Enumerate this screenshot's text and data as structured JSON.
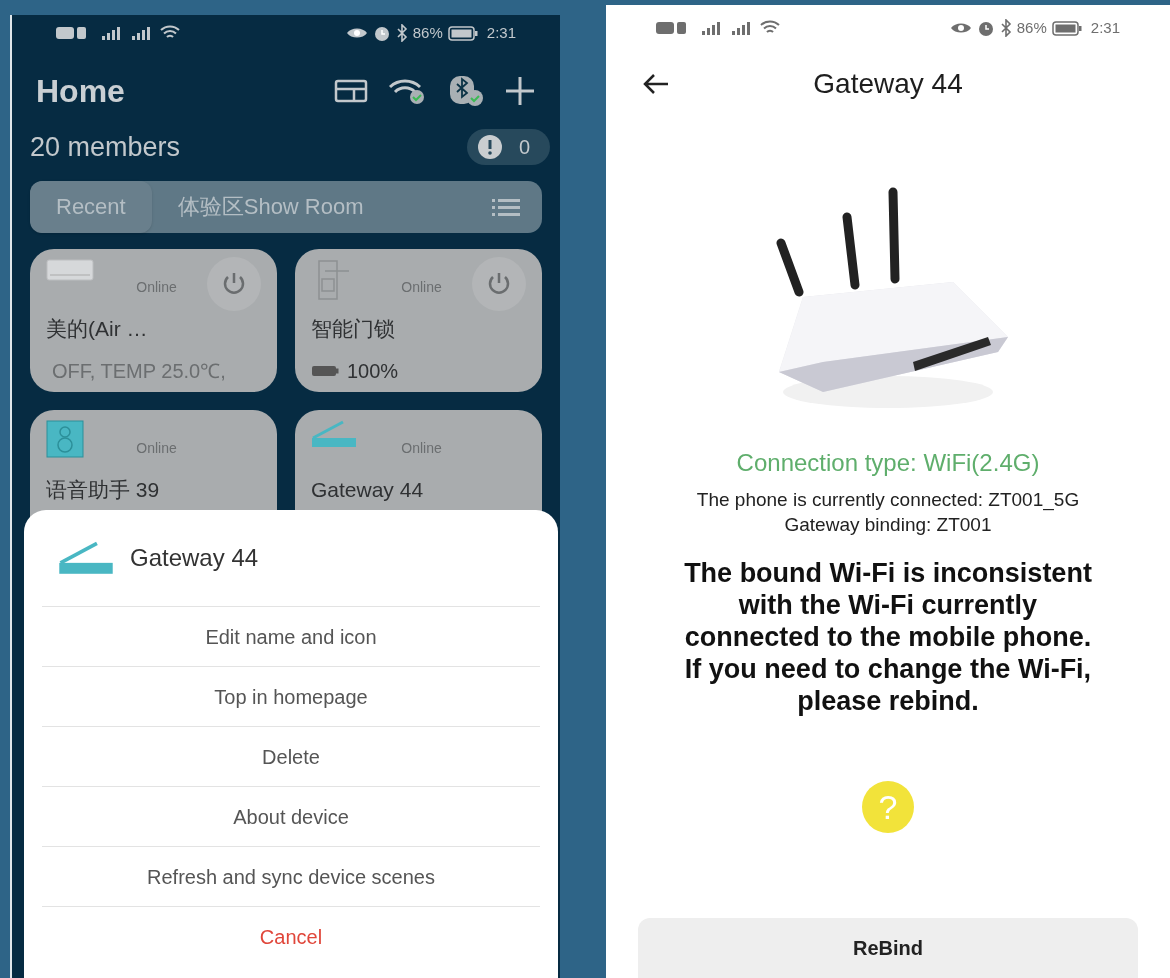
{
  "left_screen": {
    "status_bar": {
      "battery": "86%",
      "time": "2:31"
    },
    "title": "Home",
    "members": "20 members",
    "alerts_count": "0",
    "tabs": [
      {
        "label": "Recent",
        "selected": true
      },
      {
        "label": "体验区Show Room",
        "selected": false
      }
    ],
    "devices": [
      {
        "kind": "ac",
        "status": "Online",
        "name": "美的(Air …",
        "detail": "OFF, TEMP 25.0℃,",
        "has_power": true
      },
      {
        "kind": "lock",
        "status": "Online",
        "name": "智能门锁",
        "detail": "100%",
        "has_power": true
      },
      {
        "kind": "speaker",
        "status": "Online",
        "name": "语音助手 39",
        "has_power": false
      },
      {
        "kind": "gateway",
        "status": "Online",
        "name": "Gateway 44",
        "has_power": false
      }
    ],
    "action_sheet": {
      "device_name": "Gateway 44",
      "actions": [
        {
          "label": "Edit name and icon",
          "kind": "normal"
        },
        {
          "label": "Top in homepage",
          "kind": "normal"
        },
        {
          "label": "Delete",
          "kind": "normal"
        },
        {
          "label": "About device",
          "kind": "normal"
        },
        {
          "label": "Refresh and sync device scenes",
          "kind": "normal"
        },
        {
          "label": "Cancel",
          "kind": "destructive"
        }
      ]
    }
  },
  "right_screen": {
    "status_bar": {
      "battery": "86%",
      "time": "2:31"
    },
    "title": "Gateway 44",
    "connection_type": "Connection type: WiFi(2.4G)",
    "phone_connected": "The phone is currently connected: ZT001_5G",
    "gateway_binding": "Gateway binding: ZT001",
    "warning": "The bound Wi-Fi is inconsistent with the Wi-Fi currently connected to the mobile phone. If you need to change the Wi-Fi, please rebind.",
    "help": "?",
    "button": "ReBind"
  }
}
